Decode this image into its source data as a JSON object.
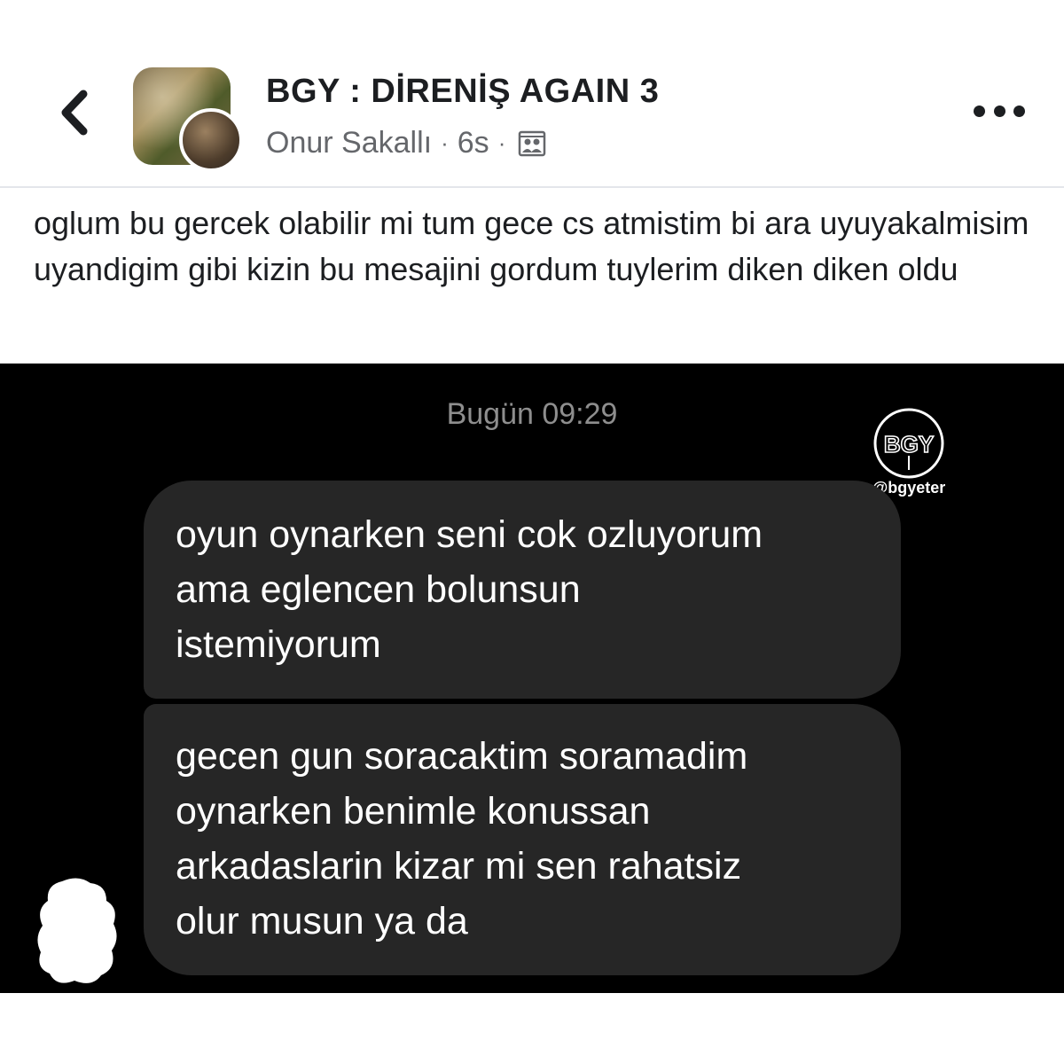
{
  "header": {
    "back_icon": "chevron-left-icon",
    "group_name": "BGY : DİRENİŞ AGAIN 3",
    "author": "Onur Sakallı",
    "separator": "·",
    "time": "6s",
    "privacy_icon": "group-members-icon",
    "more_icon": "more-horizontal-icon"
  },
  "post": {
    "text": "oglum bu gercek olabilir mi tum gece cs atmistim bi ara uyuyakalmisim uyandigim gibi kizin bu mesajini gordum tuylerim diken diken oldu"
  },
  "chat": {
    "timestamp": "Bugün 09:29",
    "watermark_logo_text": "BGY",
    "watermark_handle": "@bgyeter",
    "messages": [
      {
        "lines": [
          "oyun oynarken seni cok ozluyorum",
          "ama eglencen bolunsun",
          "istemiyorum"
        ]
      },
      {
        "lines": [
          "gecen gun soracaktim soramadim",
          "oynarken benimle konussan",
          "arkadaslarin kizar mi sen rahatsiz",
          "olur musun ya da"
        ]
      }
    ]
  },
  "colors": {
    "text_primary": "#1c1e21",
    "text_secondary": "#65676b",
    "chat_background": "#000000",
    "bubble_background": "#262626",
    "timestamp_color": "#8e8e8e"
  }
}
